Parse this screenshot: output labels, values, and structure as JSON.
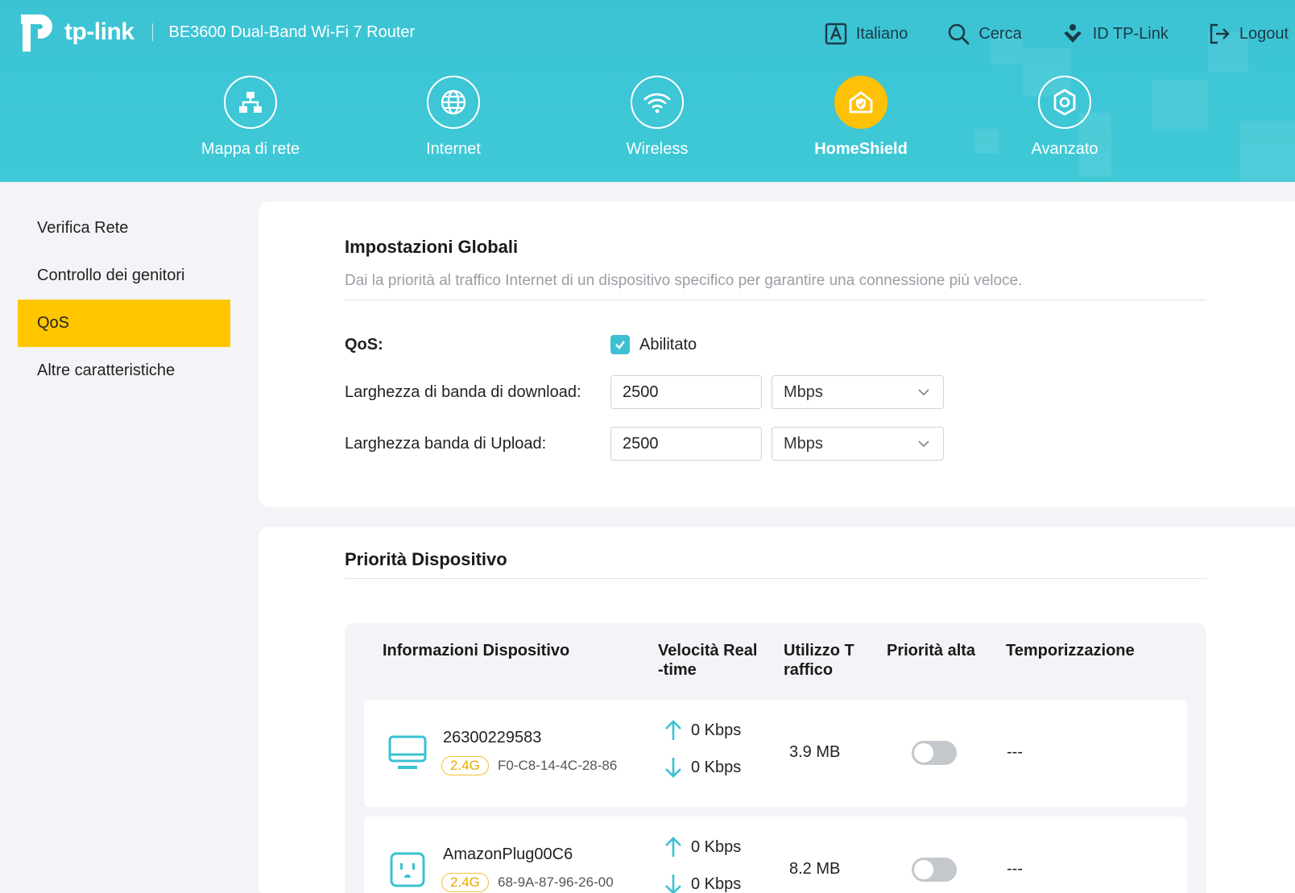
{
  "header": {
    "brand": "tp-link",
    "model": "BE3600 Dual-Band Wi-Fi 7 Router",
    "top_links": [
      {
        "label": "Italiano",
        "icon": "language-icon"
      },
      {
        "label": "Cerca",
        "icon": "search-icon"
      },
      {
        "label": "ID TP-Link",
        "icon": "tplink-id-icon"
      },
      {
        "label": "Logout",
        "icon": "logout-icon"
      }
    ],
    "nav": [
      {
        "label": "Mappa di rete",
        "icon": "network-map-icon",
        "active": false
      },
      {
        "label": "Internet",
        "icon": "globe-icon",
        "active": false
      },
      {
        "label": "Wireless",
        "icon": "wifi-icon",
        "active": false
      },
      {
        "label": "HomeShield",
        "icon": "homeshield-icon",
        "active": true
      },
      {
        "label": "Avanzato",
        "icon": "gear-icon",
        "active": false
      }
    ]
  },
  "sidebar": {
    "items": [
      {
        "label": "Verifica Rete",
        "active": false
      },
      {
        "label": "Controllo dei genitori",
        "active": false
      },
      {
        "label": "QoS",
        "active": true
      },
      {
        "label": "Altre caratteristiche",
        "active": false
      }
    ]
  },
  "global": {
    "title": "Impostazioni Globali",
    "description": "Dai la priorità al traffico Internet di un dispositivo specifico per garantire una connessione più veloce.",
    "qos_label": "QoS:",
    "qos_checkbox_label": "Abilitato",
    "qos_enabled": true,
    "download_label": "Larghezza di banda di download:",
    "download_value": "2500",
    "download_unit": "Mbps",
    "upload_label": "Larghezza banda di Upload:",
    "upload_value": "2500",
    "upload_unit": "Mbps"
  },
  "priority": {
    "title": "Priorità Dispositivo",
    "columns": {
      "info": "Informazioni Dispositivo",
      "speed_line1": "Velocità Real",
      "speed_line2": "-time",
      "usage_line1": "Utilizzo T",
      "usage_line2": "raffico",
      "high": "Priorità alta",
      "timing": "Temporizzazione"
    },
    "devices": [
      {
        "name": "26300229583",
        "band": "2.4G",
        "mac": "F0-C8-14-4C-28-86",
        "up": "0 Kbps",
        "down": "0 Kbps",
        "usage": "3.9 MB",
        "high_priority": false,
        "timing": "---",
        "icon": "computer-icon"
      },
      {
        "name": "AmazonPlug00C6",
        "band": "2.4G",
        "mac": "68-9A-87-96-26-00",
        "up": "0 Kbps",
        "down": "0 Kbps",
        "usage": "8.2 MB",
        "high_priority": false,
        "timing": "---",
        "icon": "smart-plug-icon"
      }
    ]
  },
  "colors": {
    "header": "#3fc6d5",
    "accent_yellow": "#ffc600",
    "teal": "#3cc1d3",
    "band_badge": "#f2c232"
  }
}
